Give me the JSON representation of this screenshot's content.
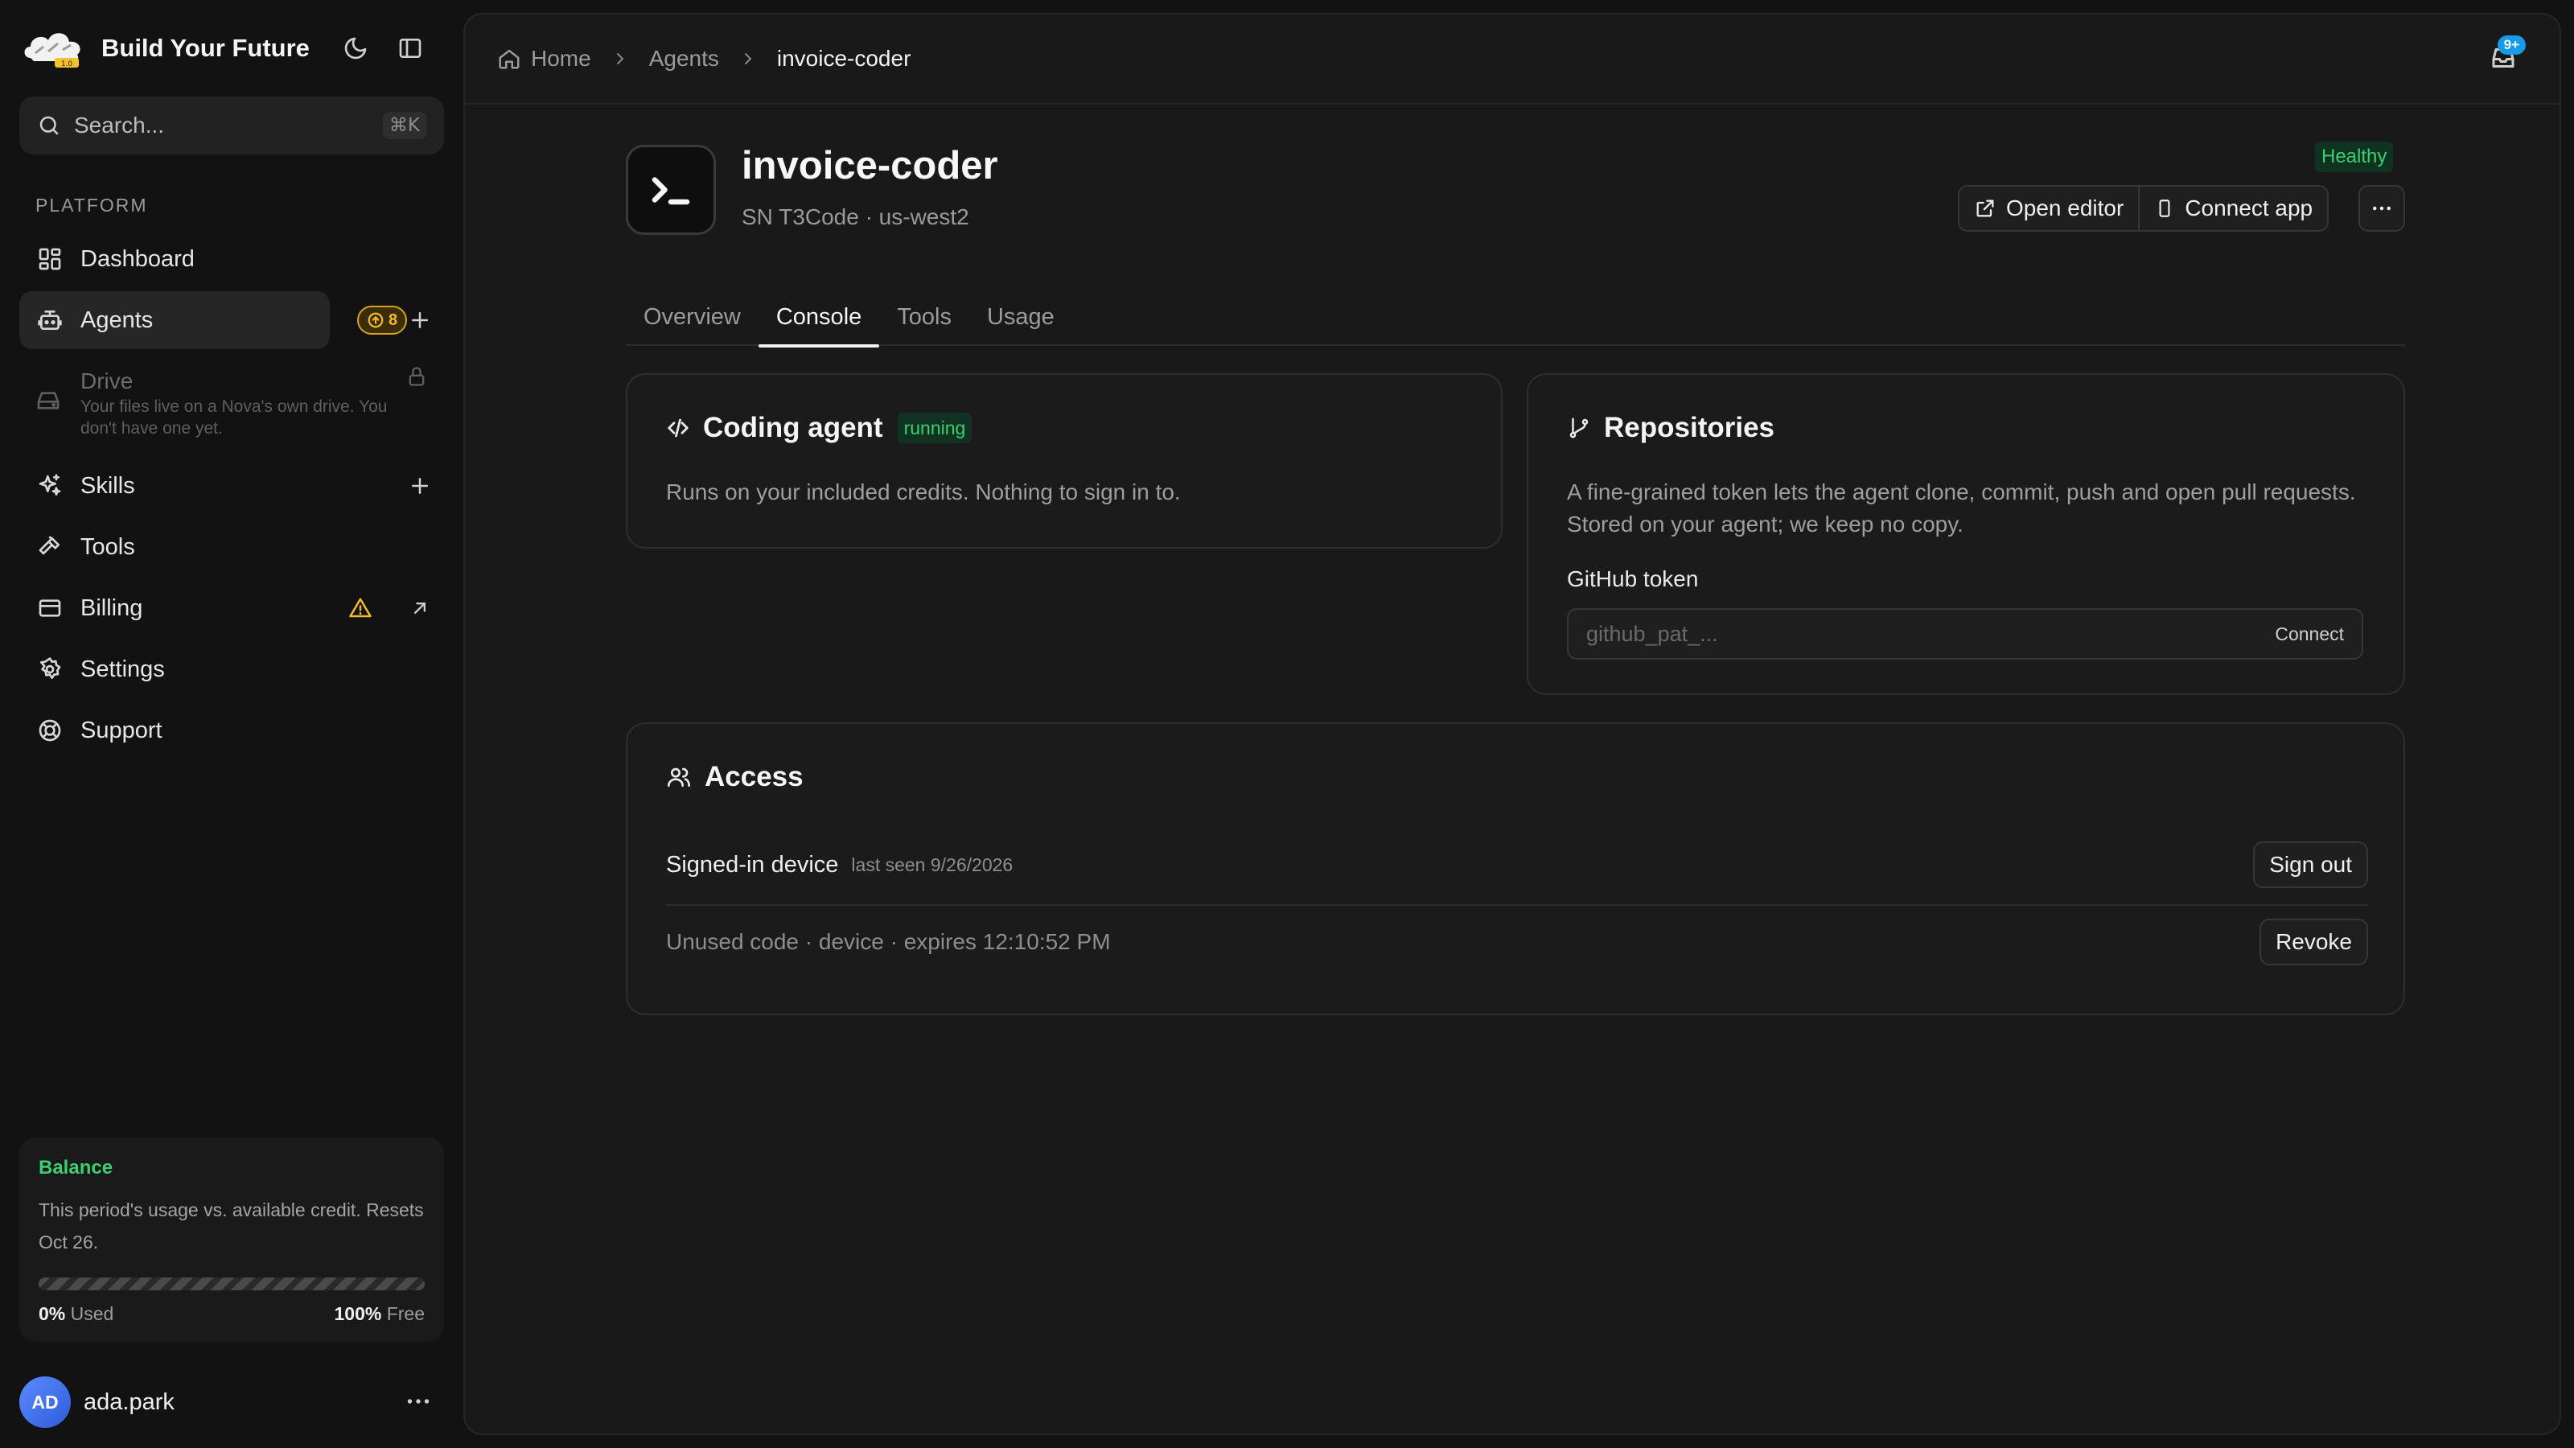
{
  "brand": {
    "name": "Build Your Future"
  },
  "search": {
    "placeholder": "Search...",
    "shortcut": "⌘K"
  },
  "sidebar": {
    "section_label": "PLATFORM",
    "items": [
      {
        "label": "Dashboard",
        "icon": "dashboard-icon"
      },
      {
        "label": "Agents",
        "icon": "robot-icon",
        "badge": "8",
        "active": true
      },
      {
        "label": "Skills",
        "icon": "sparkles-icon"
      },
      {
        "label": "Tools",
        "icon": "hammer-icon"
      },
      {
        "label": "Billing",
        "icon": "credit-card-icon",
        "warning": true
      },
      {
        "label": "Settings",
        "icon": "gear-icon"
      },
      {
        "label": "Support",
        "icon": "lifebuoy-icon"
      }
    ],
    "drive": {
      "label": "Drive",
      "description": "Your files live on a Nova's own drive. You don't have one yet."
    }
  },
  "balance": {
    "title": "Balance",
    "description": "This period's usage vs. available credit. Resets Oct 26.",
    "used_pct": "0%",
    "used_label": "Used",
    "free_pct": "100%",
    "free_label": "Free",
    "used_fraction": 0
  },
  "user": {
    "initials": "AD",
    "name": "ada.park"
  },
  "breadcrumb": {
    "home": "Home",
    "agents": "Agents",
    "current": "invoice-coder"
  },
  "notifications": {
    "count": "9+"
  },
  "agent": {
    "name": "invoice-coder",
    "subtitle": "SN T3Code · us-west2",
    "status": "Healthy",
    "open_editor": "Open editor",
    "connect_app": "Connect app"
  },
  "tabs": [
    {
      "label": "Overview",
      "active": false
    },
    {
      "label": "Console",
      "active": true
    },
    {
      "label": "Tools",
      "active": false
    },
    {
      "label": "Usage",
      "active": false
    }
  ],
  "coding_agent": {
    "title": "Coding agent",
    "status": "running",
    "description": "Runs on your included credits. Nothing to sign in to."
  },
  "repositories": {
    "title": "Repositories",
    "description": "A fine-grained token lets the agent clone, commit, push and open pull requests. Stored on your agent; we keep no copy.",
    "token_label": "GitHub token",
    "token_placeholder": "github_pat_...",
    "connect_label": "Connect"
  },
  "access": {
    "title": "Access",
    "signed_in_label": "Signed-in device",
    "signed_in_meta": "last seen 9/26/2026",
    "sign_out_label": "Sign out",
    "unused_code": "Unused code · device · expires 12:10:52 PM",
    "revoke_label": "Revoke"
  },
  "colors": {
    "accent_green": "#3ccf72",
    "warning": "#f2bb2a",
    "notification": "#169be8"
  }
}
